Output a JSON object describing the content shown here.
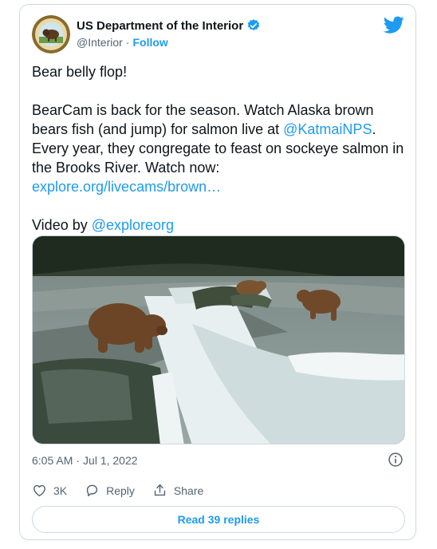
{
  "author": {
    "name": "US Department of the Interior",
    "handle": "@Interior",
    "separator": "·",
    "follow_label": "Follow",
    "avatar_icon": "department-seal-bison",
    "verified_icon": "verified-badge-icon"
  },
  "tweet": {
    "line1": "Bear belly flop!",
    "para2_text": "BearCam is back for the season. Watch Alaska brown bears fish (and jump) for salmon live at ",
    "para2_mention": "@KatmaiNPS",
    "para2_tail": ". Every year, they congregate to feast on sockeye salmon in the Brooks River. Watch now: ",
    "para2_link": "explore.org/livecams/brown…",
    "para3_text": "Video by ",
    "para3_mention": "@exploreorg"
  },
  "media": {
    "description_icon": "video-thumbnail"
  },
  "meta": {
    "time": "6:05 AM",
    "separator": "·",
    "date": "Jul 1, 2022"
  },
  "actions": {
    "likes_count": "3K",
    "reply_label": "Reply",
    "share_label": "Share"
  },
  "replies_button": "Read 39 replies",
  "colors": {
    "accent": "#1d9bf0",
    "text": "#0f1419",
    "muted": "#536471",
    "border": "#cfd9de"
  }
}
